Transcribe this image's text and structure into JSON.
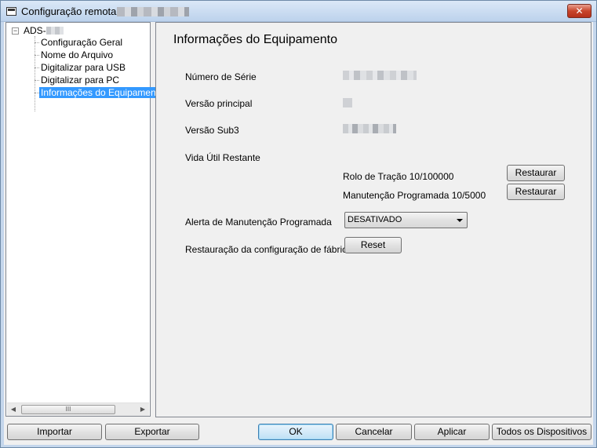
{
  "window": {
    "title": "Configuração remota -",
    "close_label": "✕"
  },
  "tree": {
    "root_label": "ADS-",
    "items": [
      {
        "label": "Configuração Geral"
      },
      {
        "label": "Nome do Arquivo"
      },
      {
        "label": "Digitalizar para USB"
      },
      {
        "label": "Digitalizar para PC"
      },
      {
        "label": "Informações do Equipamento",
        "selected": true
      }
    ],
    "scroll_thumb_label": "III"
  },
  "panel": {
    "title": "Informações do Equipamento",
    "serial_label": "Número de Série",
    "main_version_label": "Versão principal",
    "sub3_version_label": "Versão Sub3",
    "life_label": "Vida Útil Restante",
    "traction_roll_label": "Rolo de Tração 10/100000",
    "scheduled_maint_label": "Manutenção Programada 10/5000",
    "restore_label": "Restaurar",
    "alert_label": "Alerta de Manutenção Programada",
    "alert_value": "DESATIVADO",
    "factory_reset_label": "Restauração da configuração de fábrica",
    "reset_label": "Reset"
  },
  "footer": {
    "import_label": "Importar",
    "export_label": "Exportar",
    "ok_label": "OK",
    "cancel_label": "Cancelar",
    "apply_label": "Aplicar",
    "all_devices_label": "Todos os Dispositivos"
  }
}
